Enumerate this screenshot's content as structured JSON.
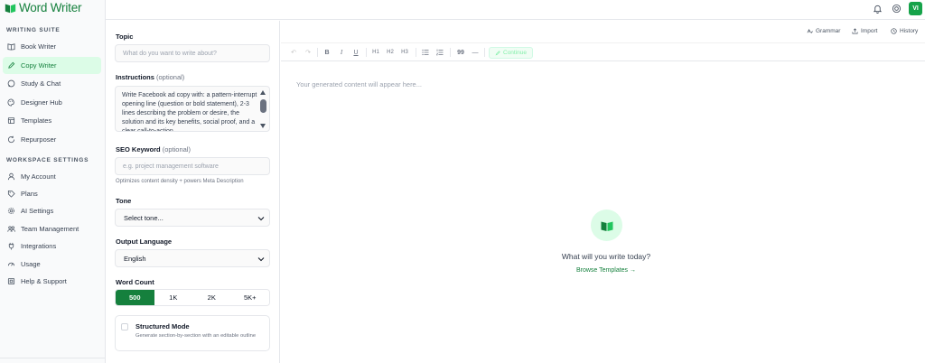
{
  "app": {
    "name": "Word Writer",
    "brand_color": "#15803d",
    "accent_light": "#dcfce7"
  },
  "sidebar": {
    "writing_title": "WRITING SUITE",
    "writing_items": [
      {
        "label": "Book Writer",
        "icon": "book-icon"
      },
      {
        "label": "Copy Writer",
        "icon": "pen-icon",
        "active": true
      },
      {
        "label": "Study & Chat",
        "icon": "chat-icon"
      },
      {
        "label": "Designer Hub",
        "icon": "palette-icon"
      },
      {
        "label": "Templates",
        "icon": "template-icon"
      },
      {
        "label": "Repurposer",
        "icon": "refresh-icon"
      }
    ],
    "settings_title": "WORKSPACE SETTINGS",
    "settings_items": [
      {
        "label": "My Account",
        "icon": "user-icon"
      },
      {
        "label": "Plans",
        "icon": "tag-icon"
      },
      {
        "label": "AI Settings",
        "icon": "gear-icon"
      },
      {
        "label": "Team Management",
        "icon": "team-icon"
      },
      {
        "label": "Integrations",
        "icon": "plug-icon"
      },
      {
        "label": "Usage",
        "icon": "gauge-icon"
      },
      {
        "label": "Help & Support",
        "icon": "help-icon"
      }
    ]
  },
  "topbar": {
    "avatar_initials": "VI"
  },
  "form": {
    "topic_label": "Topic",
    "topic_placeholder": "What do you want to write about?",
    "instructions_label": "Instructions",
    "instructions_optional": "(optional)",
    "instructions_value": "Write Facebook ad copy with: a pattern-interrupt opening line (question or bold statement), 2-3 lines describing the problem or desire, the solution and its key benefits, social proof, and a clear call-to-action.",
    "seo_label": "SEO Keyword",
    "seo_optional": "(optional)",
    "seo_placeholder": "e.g. project management software",
    "seo_hint": "Optimizes content density + powers Meta Description",
    "tone_label": "Tone",
    "tone_value": "Select tone...",
    "language_label": "Output Language",
    "language_value": "English",
    "word_count_label": "Word Count",
    "word_count_options": [
      "500",
      "1K",
      "2K",
      "5K+"
    ],
    "word_count_selected": "500",
    "structured_title": "Structured Mode",
    "structured_desc": "Generate section-by-section with an editable outline"
  },
  "editor": {
    "links": {
      "grammar": "Grammar",
      "import": "Import",
      "history": "History"
    },
    "toolbar": {
      "h1": "H1",
      "h2": "H2",
      "h3": "H3",
      "quote": "99",
      "rule": "—",
      "continue": "Continue"
    },
    "placeholder": "Your generated content will appear here...",
    "empty_title": "What will you write today?",
    "browse_link": "Browse Templates →"
  }
}
